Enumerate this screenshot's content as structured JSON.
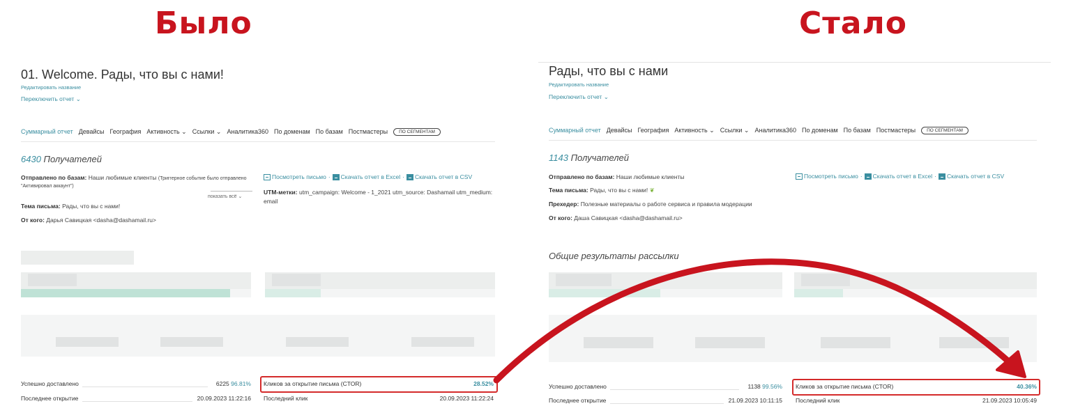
{
  "headings": {
    "before": "Было",
    "after": "Стало"
  },
  "before": {
    "title": "01. Welcome. Рады, что вы с нами!",
    "edit_name": "Редактировать название",
    "switch_report": "Переключить отчет",
    "tabs": [
      "Суммарный отчет",
      "Девайсы",
      "География",
      "Активность",
      "Ссылки",
      "Аналитика360",
      "По доменам",
      "По базам",
      "Постмастеры"
    ],
    "segment_tab": "ПО СЕГМЕНТАМ",
    "recipients_count": "6430",
    "recipients_label": "Получателей",
    "sent_label": "Отправлено по базам:",
    "sent_value": "Наши любимые клиенты",
    "sent_note": "(Триггерное событие было отправлено",
    "sent_note2": "\"Активировал аккаунт\")",
    "show_all": "показать всё",
    "subject_label": "Тема письма:",
    "subject_value": "Рады, что вы с нами!",
    "from_label": "От кого:",
    "from_value": "Дарья Савицкая <dasha@dashamail.ru>",
    "view_email": "Посмотреть письмо",
    "download_excel": "Скачать отчет в Excel",
    "download_csv": "Скачать отчет в CSV",
    "utm_label": "UTM-метки:",
    "utm_value": "utm_campaign: Welcome - 1_2021 utm_source: Dashamail utm_medium:",
    "utm_value2": "email",
    "stats": {
      "delivered_label": "Успешно доставлено",
      "delivered_count": "6225",
      "delivered_pct": "96.81%",
      "last_open_label": "Последнее открытие",
      "last_open_value": "20.09.2023 11:22:16",
      "ctor_label": "Кликов за открытие письма (CTOR)",
      "ctor_value": "28.52%",
      "last_click_label": "Последний клик",
      "last_click_value": "20.09.2023 11:22:24"
    }
  },
  "after": {
    "title": "Рады, что вы с нами",
    "edit_name": "Редактировать название",
    "switch_report": "Переключить отчет",
    "tabs": [
      "Суммарный отчет",
      "Девайсы",
      "География",
      "Активность",
      "Ссылки",
      "Аналитика360",
      "По доменам",
      "По базам",
      "Постмастеры"
    ],
    "segment_tab": "ПО СЕГМЕНТАМ",
    "recipients_count": "1143",
    "recipients_label": "Получателей",
    "sent_label": "Отправлено по базам:",
    "sent_value": "Наши любимые клиенты",
    "subject_label": "Тема письма:",
    "subject_value": "Рады, что вы с нами!",
    "preheader_label": "Прехедер:",
    "preheader_value": "Полезные материалы о работе сервиса и правила модерации",
    "from_label": "От кого:",
    "from_value": "Даша Савицкая <dasha@dashamail.ru>",
    "view_email": "Посмотреть письмо",
    "download_excel": "Скачать отчет в Excel",
    "download_csv": "Скачать отчет в CSV",
    "results_title": "Общие результаты рассылки",
    "stats": {
      "delivered_label": "Успешно доставлено",
      "delivered_count": "1138",
      "delivered_pct": "99.56%",
      "last_open_label": "Последнее открытие",
      "last_open_value": "21.09.2023 10:11:15",
      "ctor_label": "Кликов за открытие письма (CTOR)",
      "ctor_value": "40.36%",
      "last_click_label": "Последний клик",
      "last_click_value": "21.09.2023 10:05:49"
    }
  },
  "colors": {
    "accent": "#3a8ea0",
    "highlight": "#d42a2a",
    "heading": "#c8141e"
  },
  "icons": [
    "chevron-down-icon",
    "email-preview-icon",
    "excel-icon",
    "csv-icon",
    "leaf-emoji-icon",
    "curved-arrow-icon"
  ]
}
